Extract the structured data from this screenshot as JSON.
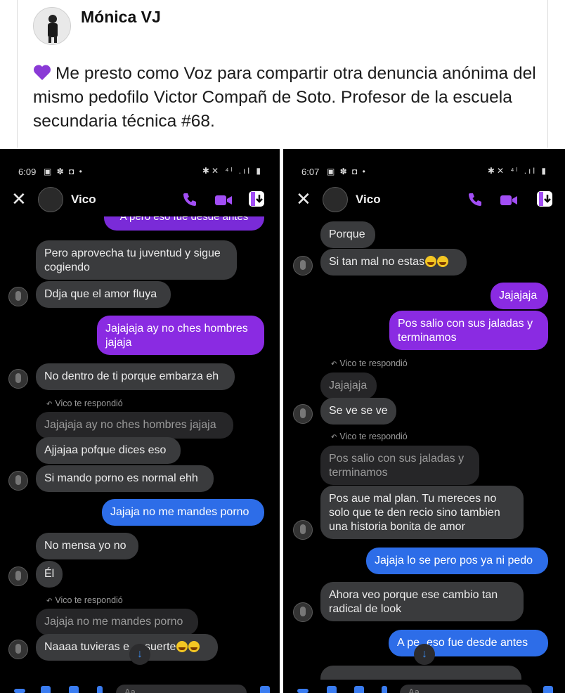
{
  "post": {
    "author": "Mónica VJ",
    "text": "Me presto como Voz para compartir otra denuncia anónima del mismo pedofilo Victor Compañ de Soto. Profesor de la escuela secundaria técnica #68.",
    "heart_icon": "purple-heart-icon",
    "heart_color": "#8a3ad6"
  },
  "left": {
    "status_time": "6:09",
    "contact": "Vico",
    "clipped_top": "A pero eso fue desde antes",
    "m1": "Pero aprovecha tu juventud y sigue cogiendo",
    "m2": "Ddja que el amor fluya",
    "m3": "Jajajaja ay no ches hombres jajaja",
    "m4": "No dentro de ti porque embarza eh",
    "reply1": "Vico te respondió",
    "q1": "Jajajaja ay no ches hombres jajaja",
    "m5": "Ajjajaa pofque dices eso",
    "m6": "Si mando porno es normal ehh",
    "m7": "Jajaja no me mandes porno",
    "m8": "No mensa yo no",
    "m9": "Él",
    "reply2": "Vico te respondió",
    "q2": "Jajaja no me mandes porno",
    "m10a": "Naaaa tuvieras e",
    "m10b": "suerte",
    "composer_placeholder": "Aa"
  },
  "right": {
    "status_time": "6:07",
    "contact": "Vico",
    "m1": "Porque",
    "m2": "Si tan mal no estas",
    "m3": "Jajajaja",
    "m4": "Pos salio con sus jaladas y terminamos",
    "reply1": "Vico te respondió",
    "q1": "Jajajaja",
    "m5": "Se ve se ve",
    "reply2": "Vico te respondió",
    "q2": "Pos salio con sus jaladas y terminamos",
    "m6": "Pos aue mal plan. Tu mereces no solo que te den recio sino tambien una historia bonita de amor",
    "m7": "Jajaja lo se pero pos ya ni pedo",
    "m8": "Ahora veo porque ese cambio tan radical de look",
    "m9a": "A pe",
    "m9b": "eso fue desde antes",
    "composer_placeholder": "Aa"
  },
  "colors": {
    "accent_purple": "#8a2be2",
    "accent_blue": "#2d6de8",
    "incoming_bubble": "#3a3b3d",
    "icon_purple": "#a24ef5"
  }
}
